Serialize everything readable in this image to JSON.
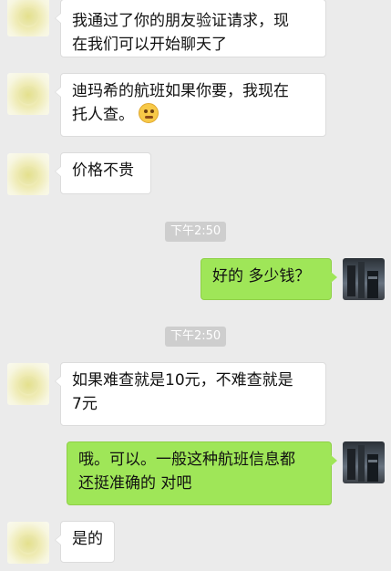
{
  "messages": [
    {
      "side": "left",
      "line1": "我通过了你的朋友验证请求，现",
      "line2": "在我们可以开始聊天了"
    },
    {
      "side": "left",
      "line1": "迪玛希的航班如果你要，我现在",
      "line2": "托人查。",
      "emoji": "pondering-face"
    },
    {
      "side": "left",
      "line1": "价格不贵"
    },
    {
      "side": "time",
      "text": "下午2:50"
    },
    {
      "side": "right",
      "line1": "好的 多少钱？"
    },
    {
      "side": "time",
      "text": "下午2:50"
    },
    {
      "side": "left",
      "line1": "如果难查就是10元，不难查就是",
      "line2": "7元"
    },
    {
      "side": "right",
      "line1": "哦。可以。一般这种航班信息都",
      "line2": "还挺准确的 对吧"
    },
    {
      "side": "left",
      "line1": "是的"
    }
  ],
  "colors": {
    "background": "#ebebeb",
    "incoming_bubble": "#ffffff",
    "outgoing_bubble": "#9fe658",
    "timestamp_pill": "#cecece"
  },
  "icons": {
    "contact_avatar": "yellow-chick-avatar",
    "self_avatar": "city-photo-avatar",
    "emoji": "pondering-face-emoji"
  }
}
